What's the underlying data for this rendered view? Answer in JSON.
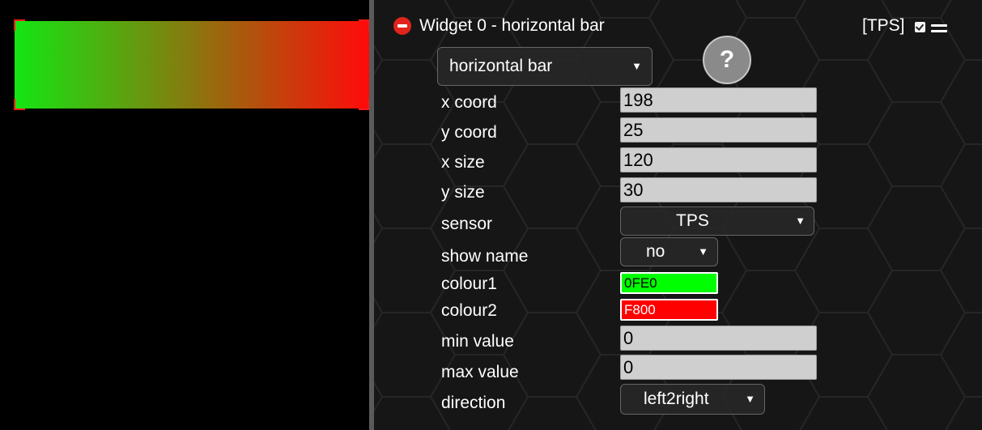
{
  "preview": {
    "bar": {
      "colour_start": "#13e613",
      "colour_end": "#ff0a0a",
      "selection_colour": "#ff1a1a"
    }
  },
  "widget": {
    "title": "Widget 0 - horizontal bar",
    "tag": "[TPS]",
    "checkbox_checked": true,
    "type_select": {
      "value": "horizontal bar"
    },
    "help_label": "?",
    "fields": {
      "x_coord": {
        "label": "x coord",
        "value": "198"
      },
      "y_coord": {
        "label": "y coord",
        "value": "25"
      },
      "x_size": {
        "label": "x size",
        "value": "120"
      },
      "y_size": {
        "label": "y size",
        "value": "30"
      },
      "sensor": {
        "label": "sensor",
        "value": "TPS"
      },
      "show_name": {
        "label": "show name",
        "value": "no"
      },
      "colour1": {
        "label": "colour1",
        "value": "0FE0",
        "swatch": "#00ff00"
      },
      "colour2": {
        "label": "colour2",
        "value": "F800",
        "swatch": "#ff0000"
      },
      "min_value": {
        "label": "min value",
        "value": "0"
      },
      "max_value": {
        "label": "max value",
        "value": "0"
      },
      "direction": {
        "label": "direction",
        "value": "left2right"
      }
    }
  },
  "colors": {
    "panel_bg": "#161616",
    "hex_line": "#262626",
    "remove_icon": "#e0241c",
    "input_bg": "#cfcfcf",
    "splitter": "#5a5a5a"
  },
  "icons": {
    "remove": "remove-widget-icon",
    "checkbox": "checkbox-icon",
    "menu": "hamburger-menu-icon",
    "dropdown": "chevron-down-icon",
    "help": "help-icon"
  }
}
